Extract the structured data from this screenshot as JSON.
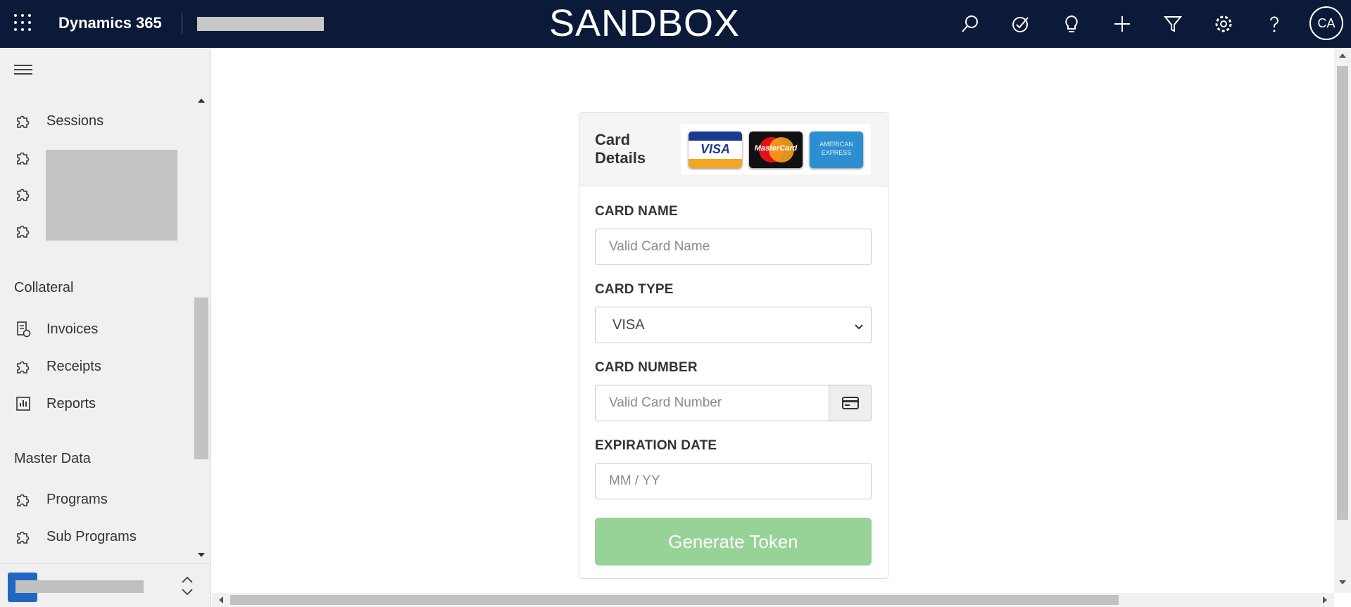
{
  "topbar": {
    "app_title": "Dynamics 365",
    "environment": "SANDBOX",
    "avatar_initials": "CA",
    "background_color": "#0b1a38"
  },
  "sidebar": {
    "items_top": [
      {
        "label": "Sessions",
        "icon": "puzzle-icon"
      }
    ],
    "groups": [
      {
        "title": "Collateral",
        "items": [
          {
            "label": "Invoices",
            "icon": "invoice-icon"
          },
          {
            "label": "Receipts",
            "icon": "puzzle-icon"
          },
          {
            "label": "Reports",
            "icon": "report-icon"
          }
        ]
      },
      {
        "title": "Master Data",
        "items": [
          {
            "label": "Programs",
            "icon": "puzzle-icon"
          },
          {
            "label": "Sub Programs",
            "icon": "puzzle-icon"
          }
        ]
      }
    ]
  },
  "card": {
    "title": "Card Details",
    "logos": {
      "visa": "VISA",
      "mastercard": "MasterCard",
      "amex_line1": "AMERICAN",
      "amex_line2": "EXPRESS"
    },
    "card_name": {
      "label": "CARD NAME",
      "placeholder": "Valid Card Name",
      "value": ""
    },
    "card_type": {
      "label": "CARD TYPE",
      "selected": "VISA"
    },
    "card_number": {
      "label": "CARD NUMBER",
      "placeholder": "Valid Card Number",
      "value": ""
    },
    "expiration": {
      "label": "EXPIRATION DATE",
      "placeholder": "MM / YY",
      "value": ""
    },
    "submit_label": "Generate Token",
    "button_color": "#97d297"
  }
}
